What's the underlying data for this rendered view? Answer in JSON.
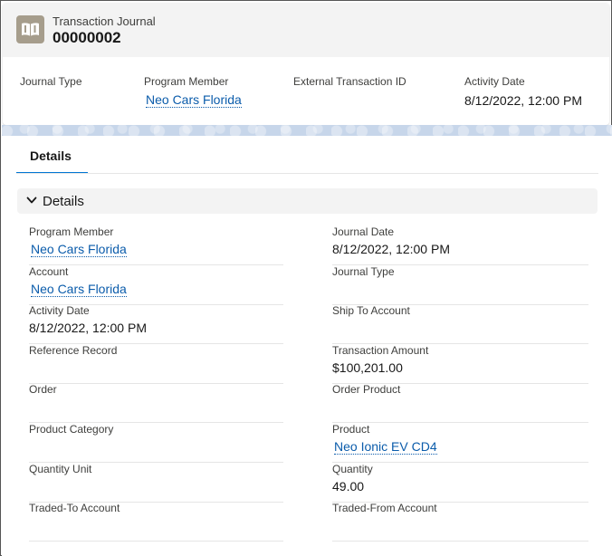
{
  "header": {
    "object_type": "Transaction Journal",
    "record_name": "00000002",
    "icon": "journal-book-icon",
    "highlights": [
      {
        "label": "Journal Type",
        "value": "",
        "is_link": false
      },
      {
        "label": "Program Member",
        "value": "Neo Cars Florida",
        "is_link": true
      },
      {
        "label": "External Transaction ID",
        "value": "",
        "is_link": false
      },
      {
        "label": "Activity Date",
        "value": "8/12/2022, 12:00 PM",
        "is_link": false
      }
    ]
  },
  "tabs": [
    {
      "label": "Details",
      "active": true
    }
  ],
  "section": {
    "title": "Details",
    "expanded": true,
    "fields": [
      {
        "label": "Program Member",
        "value": "Neo Cars Florida",
        "is_link": true
      },
      {
        "label": "Journal Date",
        "value": "8/12/2022, 12:00 PM",
        "is_link": false
      },
      {
        "label": "Account",
        "value": "Neo Cars Florida",
        "is_link": true
      },
      {
        "label": "Journal Type",
        "value": "",
        "is_link": false
      },
      {
        "label": "Activity Date",
        "value": "8/12/2022, 12:00 PM",
        "is_link": false
      },
      {
        "label": "Ship To Account",
        "value": "",
        "is_link": false
      },
      {
        "label": "Reference Record",
        "value": "",
        "is_link": false
      },
      {
        "label": "Transaction Amount",
        "value": "$100,201.00",
        "is_link": false
      },
      {
        "label": "Order",
        "value": "",
        "is_link": false
      },
      {
        "label": "Order Product",
        "value": "",
        "is_link": false
      },
      {
        "label": "Product Category",
        "value": "",
        "is_link": false
      },
      {
        "label": "Product",
        "value": "Neo Ionic EV CD4",
        "is_link": true
      },
      {
        "label": "Quantity Unit",
        "value": "",
        "is_link": false
      },
      {
        "label": "Quantity",
        "value": "49.00",
        "is_link": false
      },
      {
        "label": "Traded-To Account",
        "value": "",
        "is_link": false
      },
      {
        "label": "Traded-From Account",
        "value": "",
        "is_link": false
      }
    ]
  },
  "colors": {
    "link": "#0b5cab",
    "icon_bg": "#a69d8c",
    "tab_active": "#0176d3"
  }
}
